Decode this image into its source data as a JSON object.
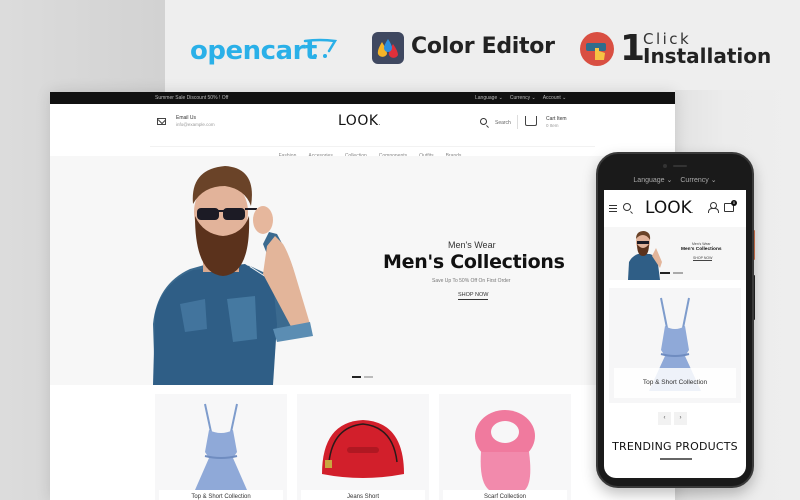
{
  "banner": {
    "opencart_label": "opencart",
    "color_editor_label": "Color Editor",
    "install_number": "1",
    "install_click": "Click",
    "install_label": "Installation"
  },
  "colors": {
    "opencart_blue": "#2ab0e8",
    "install_red": "#d94f42",
    "topbar_black": "#111111"
  },
  "desktop": {
    "topbar": {
      "promo": "Summer Sale Discount 50% ! Off",
      "links": [
        "Language ⌄",
        "Currency ⌄",
        "Account ⌄"
      ]
    },
    "header": {
      "email_title": "Email Us",
      "email_value": "info@example.com",
      "logo": "LOOK",
      "logo_dot": ".",
      "search_label": "Search",
      "cart_title": "Cart Item",
      "cart_count": "0 Item"
    },
    "nav": [
      "Fashion",
      "Accesories",
      "Collection",
      "Components",
      "Outfits",
      "Brands"
    ],
    "hero": {
      "subtitle": "Men's Wear",
      "title": "Men's Collections",
      "description": "Save Up To 50% Off On First Order",
      "cta": "SHOP NOW",
      "active_slide": 1,
      "slide_count": 2
    },
    "categories": [
      {
        "label": "Top & Short Collection",
        "icon": "dress-image"
      },
      {
        "label": "Jeans Short",
        "icon": "handbag-image"
      },
      {
        "label": "Scarf Collection",
        "icon": "scarf-image"
      }
    ]
  },
  "phone": {
    "topbar": [
      "Language ⌄",
      "Currency ⌄"
    ],
    "logo": "LOOK",
    "logo_dot": ".",
    "cart_badge": "0",
    "hero": {
      "subtitle": "Men's Wear",
      "title": "Men's Collections",
      "cta": "SHOP NOW",
      "active_slide": 1,
      "slide_count": 2
    },
    "category_label": "Top & Short Collection",
    "prev": "‹",
    "next": "›",
    "section_title": "TRENDING PRODUCTS"
  }
}
